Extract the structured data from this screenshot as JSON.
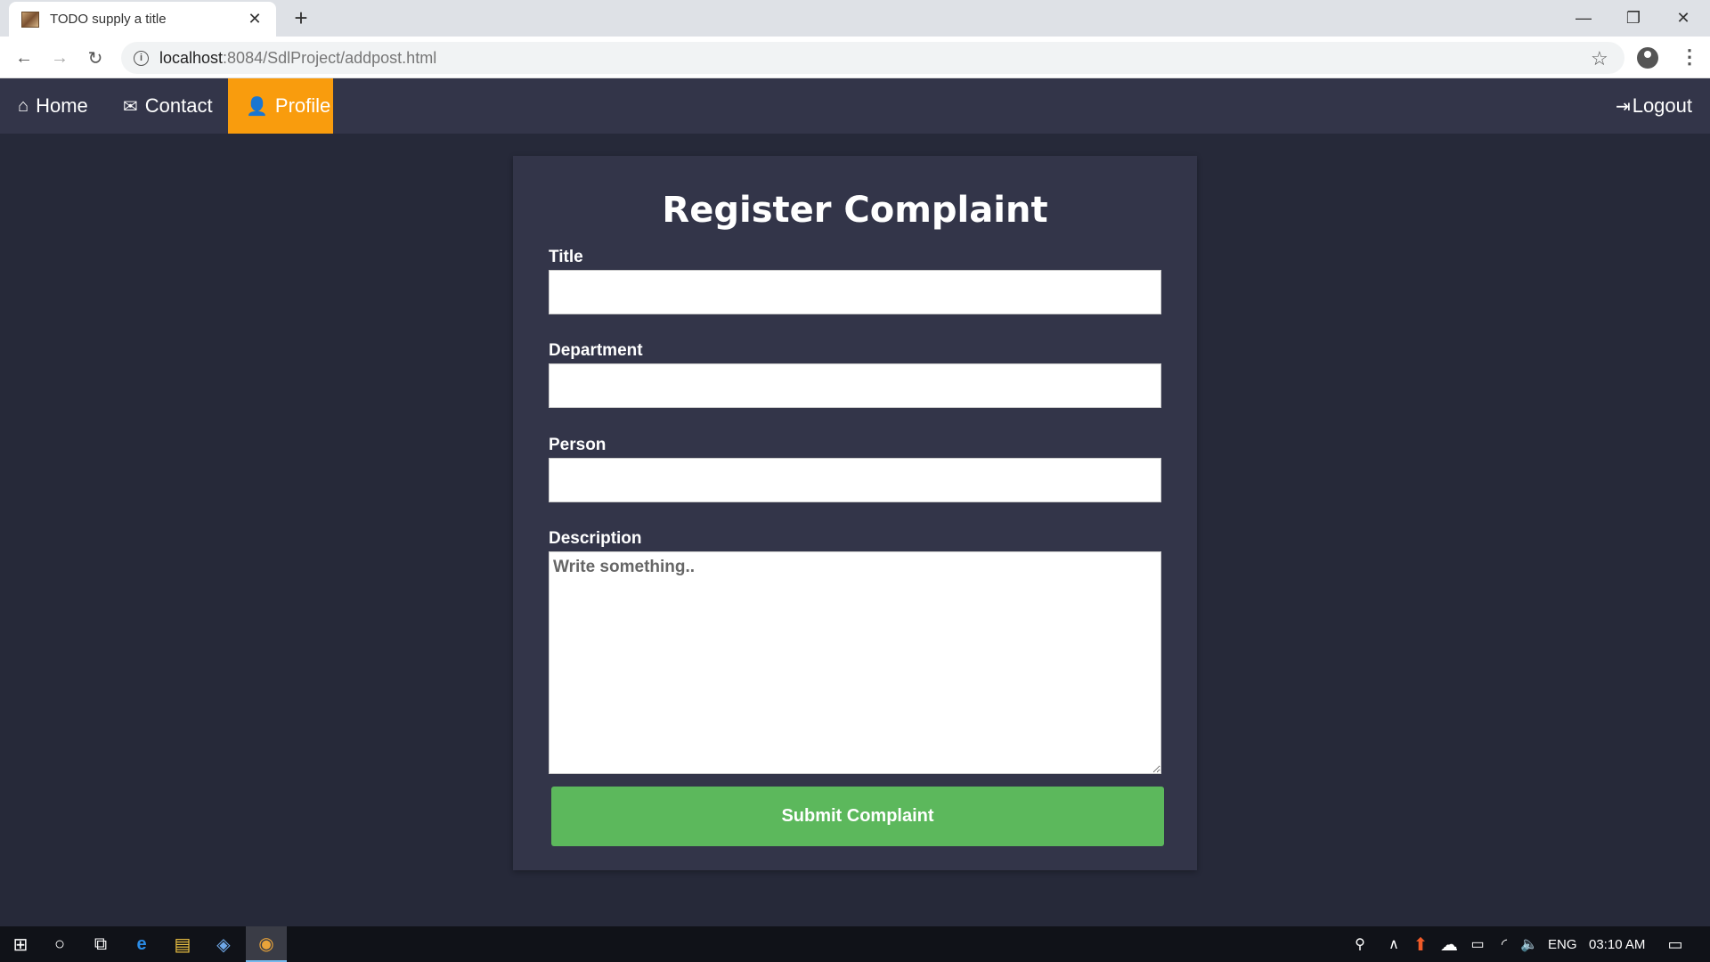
{
  "browser": {
    "tab_title": "TODO supply a title",
    "url_host": "localhost",
    "url_rest": ":8084/SdlProject/addpost.html"
  },
  "nav": {
    "home": "Home",
    "contact": "Contact",
    "profile": "Profile",
    "logout": "Logout",
    "active_color": "#f99c0d"
  },
  "form": {
    "title": "Register Complaint",
    "title_label": "Title",
    "department_label": "Department",
    "person_label": "Person",
    "description_label": "Description",
    "description_placeholder": "Write something..",
    "submit_label": "Submit Complaint",
    "submit_color": "#5cb85c"
  },
  "taskbar": {
    "language": "ENG",
    "time": "03:10 AM"
  }
}
